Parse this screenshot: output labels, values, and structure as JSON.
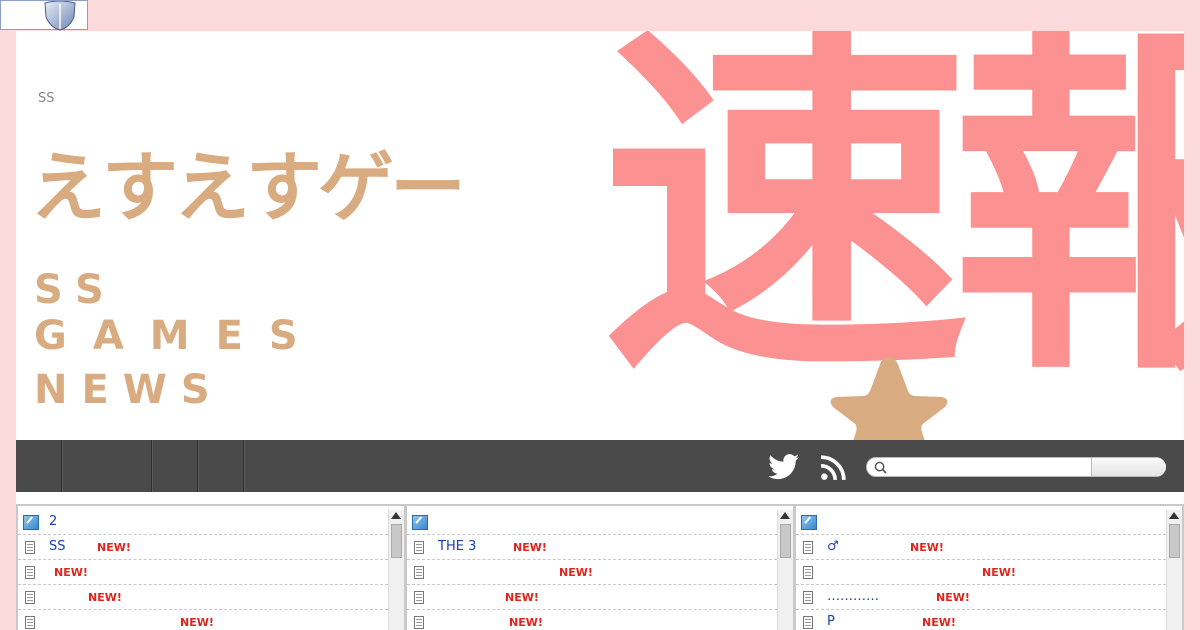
{
  "site": {
    "small_label": "SS",
    "kana_title": "えすえすゲー",
    "en_line1": "SS",
    "en_line2": "GAMES",
    "en_line3": "NEWS",
    "kanji_title": "速報",
    "colors": {
      "background": "#fcd9db",
      "kana": "#d9ab80",
      "kanji": "#fb9191",
      "nav": "#4a4a4a",
      "link": "#1a3fb0",
      "new": "#e0241c"
    }
  },
  "nav": {
    "items": [
      "",
      "",
      "",
      ""
    ],
    "twitter_icon": "twitter-bird-icon",
    "rss_icon": "rss-feed-icon",
    "search": {
      "value": "",
      "placeholder": ""
    }
  },
  "panels": [
    {
      "title": "2",
      "rows": [
        {
          "text": "SS",
          "badge": "NEW!"
        },
        {
          "text": "",
          "badge": "NEW!"
        },
        {
          "text": "",
          "badge": "NEW!"
        },
        {
          "text": "",
          "badge": "NEW!"
        }
      ]
    },
    {
      "title": "",
      "rows": [
        {
          "text": "THE 3",
          "badge": "NEW!"
        },
        {
          "text": "",
          "badge": "NEW!"
        },
        {
          "text": "",
          "badge": "NEW!"
        },
        {
          "text": "",
          "badge": "NEW!"
        }
      ]
    },
    {
      "title": "",
      "rows": [
        {
          "text": "♂",
          "badge": "NEW!"
        },
        {
          "text": "",
          "badge": "NEW!"
        },
        {
          "text": "…………",
          "badge": "NEW!"
        },
        {
          "text": "P",
          "badge": "NEW!"
        }
      ]
    }
  ]
}
